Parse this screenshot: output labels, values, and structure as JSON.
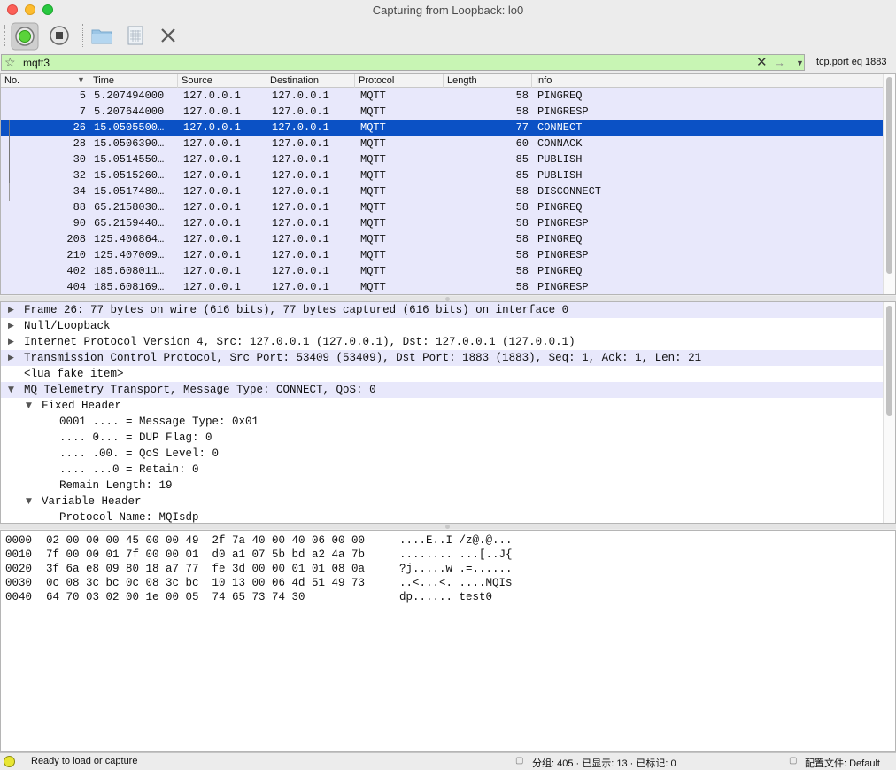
{
  "window": {
    "title": "Capturing from Loopback: lo0"
  },
  "toolbar": {
    "buttons": [
      "start-capture",
      "stop-capture",
      "open-file",
      "save-file",
      "close-file"
    ]
  },
  "filter": {
    "value": "mqtt3",
    "expression": "tcp.port eq 1883"
  },
  "packet_list": {
    "columns": [
      "No.",
      "Time",
      "Source",
      "Destination",
      "Protocol",
      "Length",
      "Info"
    ],
    "rows": [
      {
        "no": "5",
        "time": "5.207494000",
        "src": "127.0.0.1",
        "dst": "127.0.0.1",
        "proto": "MQTT",
        "len": "58",
        "info": "PINGREQ"
      },
      {
        "no": "7",
        "time": "5.207644000",
        "src": "127.0.0.1",
        "dst": "127.0.0.1",
        "proto": "MQTT",
        "len": "58",
        "info": "PINGRESP"
      },
      {
        "no": "26",
        "time": "15.0505500…",
        "src": "127.0.0.1",
        "dst": "127.0.0.1",
        "proto": "MQTT",
        "len": "77",
        "info": "CONNECT"
      },
      {
        "no": "28",
        "time": "15.0506390…",
        "src": "127.0.0.1",
        "dst": "127.0.0.1",
        "proto": "MQTT",
        "len": "60",
        "info": "CONNACK"
      },
      {
        "no": "30",
        "time": "15.0514550…",
        "src": "127.0.0.1",
        "dst": "127.0.0.1",
        "proto": "MQTT",
        "len": "85",
        "info": "PUBLISH"
      },
      {
        "no": "32",
        "time": "15.0515260…",
        "src": "127.0.0.1",
        "dst": "127.0.0.1",
        "proto": "MQTT",
        "len": "85",
        "info": "PUBLISH"
      },
      {
        "no": "34",
        "time": "15.0517480…",
        "src": "127.0.0.1",
        "dst": "127.0.0.1",
        "proto": "MQTT",
        "len": "58",
        "info": "DISCONNECT"
      },
      {
        "no": "88",
        "time": "65.2158030…",
        "src": "127.0.0.1",
        "dst": "127.0.0.1",
        "proto": "MQTT",
        "len": "58",
        "info": "PINGREQ"
      },
      {
        "no": "90",
        "time": "65.2159440…",
        "src": "127.0.0.1",
        "dst": "127.0.0.1",
        "proto": "MQTT",
        "len": "58",
        "info": "PINGRESP"
      },
      {
        "no": "208",
        "time": "125.406864…",
        "src": "127.0.0.1",
        "dst": "127.0.0.1",
        "proto": "MQTT",
        "len": "58",
        "info": "PINGREQ"
      },
      {
        "no": "210",
        "time": "125.407009…",
        "src": "127.0.0.1",
        "dst": "127.0.0.1",
        "proto": "MQTT",
        "len": "58",
        "info": "PINGRESP"
      },
      {
        "no": "402",
        "time": "185.608011…",
        "src": "127.0.0.1",
        "dst": "127.0.0.1",
        "proto": "MQTT",
        "len": "58",
        "info": "PINGREQ"
      },
      {
        "no": "404",
        "time": "185.608169…",
        "src": "127.0.0.1",
        "dst": "127.0.0.1",
        "proto": "MQTT",
        "len": "58",
        "info": "PINGRESP"
      }
    ],
    "selected_no": "26"
  },
  "details": [
    {
      "indent": 0,
      "toggle": "collapsed",
      "text": "Frame 26: 77 bytes on wire (616 bits), 77 bytes captured (616 bits) on interface 0",
      "shaded": true
    },
    {
      "indent": 0,
      "toggle": "collapsed",
      "text": "Null/Loopback",
      "shaded": false
    },
    {
      "indent": 0,
      "toggle": "collapsed",
      "text": "Internet Protocol Version 4, Src: 127.0.0.1 (127.0.0.1), Dst: 127.0.0.1 (127.0.0.1)",
      "shaded": false
    },
    {
      "indent": 0,
      "toggle": "collapsed",
      "text": "Transmission Control Protocol, Src Port: 53409 (53409), Dst Port: 1883 (1883), Seq: 1, Ack: 1, Len: 21",
      "shaded": true
    },
    {
      "indent": 0,
      "toggle": "none",
      "text": "<lua fake item>",
      "shaded": false
    },
    {
      "indent": 0,
      "toggle": "expanded",
      "text": "MQ Telemetry Transport, Message Type: CONNECT, QoS: 0",
      "shaded": true
    },
    {
      "indent": 1,
      "toggle": "expanded",
      "text": "Fixed Header",
      "shaded": false
    },
    {
      "indent": 2,
      "toggle": "none",
      "text": "0001 .... = Message Type: 0x01",
      "shaded": false
    },
    {
      "indent": 2,
      "toggle": "none",
      "text": ".... 0... = DUP Flag: 0",
      "shaded": false
    },
    {
      "indent": 2,
      "toggle": "none",
      "text": ".... .00. = QoS Level: 0",
      "shaded": false
    },
    {
      "indent": 2,
      "toggle": "none",
      "text": ".... ...0 = Retain: 0",
      "shaded": false
    },
    {
      "indent": 2,
      "toggle": "none",
      "text": "Remain Length: 19",
      "shaded": false
    },
    {
      "indent": 1,
      "toggle": "expanded",
      "text": "Variable Header",
      "shaded": false
    },
    {
      "indent": 2,
      "toggle": "none",
      "text": "Protocol Name: MQIsdp",
      "shaded": false
    }
  ],
  "bytes": [
    {
      "offset": "0000",
      "hex": "02 00 00 00 45 00 00 49  2f 7a 40 00 40 06 00 00",
      "ascii": "....E..I /z@.@..."
    },
    {
      "offset": "0010",
      "hex": "7f 00 00 01 7f 00 00 01  d0 a1 07 5b bd a2 4a 7b",
      "ascii": "........ ...[..J{"
    },
    {
      "offset": "0020",
      "hex": "3f 6a e8 09 80 18 a7 77  fe 3d 00 00 01 01 08 0a",
      "ascii": "?j.....w .=......"
    },
    {
      "offset": "0030",
      "hex": "0c 08 3c bc 0c 08 3c bc  10 13 00 06 4d 51 49 73",
      "ascii": "..<...<. ....MQIs"
    },
    {
      "offset": "0040",
      "hex": "64 70 03 02 00 1e 00 05  74 65 73 74 30",
      "ascii": "dp...... test0"
    }
  ],
  "status": {
    "message": "Ready to load or capture",
    "packets": "分组: 405 · 已显示: 13 · 已标记: 0",
    "profile": "配置文件: Default"
  },
  "colors": {
    "filter_valid": "#c8f5b4",
    "row_bg": "#e8e8fb",
    "selected_bg": "#0b51c5"
  }
}
